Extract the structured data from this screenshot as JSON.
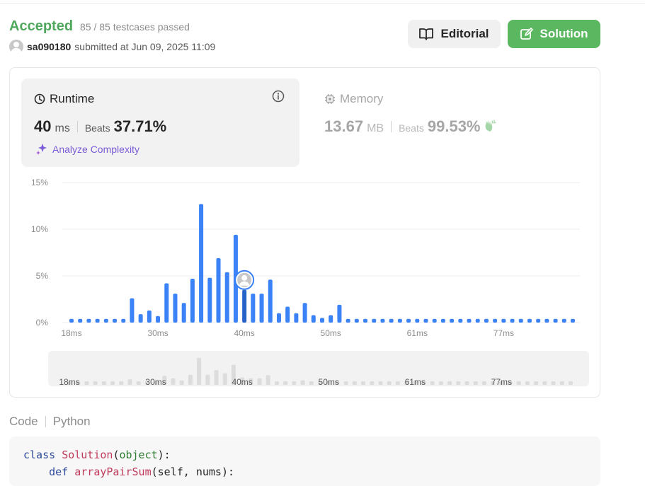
{
  "status": {
    "label": "Accepted",
    "testcases": "85 / 85 testcases passed"
  },
  "submission": {
    "user": "sa090180",
    "submitted_text": "submitted at Jun 09, 2025 11:09"
  },
  "buttons": {
    "editorial": "Editorial",
    "solution": "Solution"
  },
  "runtime": {
    "title": "Runtime",
    "value": "40",
    "unit": "ms",
    "beats_label": "Beats",
    "beats_value": "37.71%",
    "analyze": "Analyze Complexity"
  },
  "memory": {
    "title": "Memory",
    "value": "13.67",
    "unit": "MB",
    "beats_label": "Beats",
    "beats_value": "99.53%"
  },
  "colors": {
    "accepted": "#4fa85c",
    "bar": "#3b82f6",
    "accent": "#5cb860",
    "analyze": "#7b5cd6"
  },
  "chart_data": {
    "type": "bar",
    "y_ticks": [
      "15%",
      "10%",
      "5%",
      "0%"
    ],
    "ylim": [
      0,
      15
    ],
    "x_tick_labels": [
      "18ms",
      "30ms",
      "40ms",
      "50ms",
      "61ms",
      "77ms"
    ],
    "values": [
      0.4,
      0.4,
      0.4,
      0.4,
      0.4,
      0.4,
      0.4,
      2.6,
      0.9,
      1.3,
      0.7,
      4.2,
      3.1,
      2.1,
      4.7,
      12.7,
      4.8,
      6.9,
      5.4,
      9.4,
      3.5,
      3.1,
      3.1,
      4.6,
      1.0,
      1.7,
      1.0,
      2.1,
      0.8,
      0.5,
      0.8,
      1.9,
      0.4,
      0.4,
      0.4,
      0.4,
      0.4,
      0.4,
      0.4,
      0.4,
      0.4,
      0.4,
      0.4,
      0.4,
      0.4,
      0.4,
      0.4,
      0.4,
      0.4,
      0.4,
      0.4,
      0.4,
      0.4,
      0.4,
      0.4,
      0.4,
      0.4,
      0.4,
      0.4
    ],
    "highlighted_index": 20,
    "grid": true
  },
  "code": {
    "tab_label": "Code",
    "language": "Python",
    "lines": [
      [
        {
          "t": "class ",
          "c": "kw"
        },
        {
          "t": "Solution",
          "c": "cls"
        },
        {
          "t": "(",
          "c": "plain"
        },
        {
          "t": "object",
          "c": "bi"
        },
        {
          "t": "):",
          "c": "plain"
        }
      ],
      [
        {
          "t": "    ",
          "c": "plain"
        },
        {
          "t": "def ",
          "c": "kw"
        },
        {
          "t": "arrayPairSum",
          "c": "cls"
        },
        {
          "t": "(self, nums):",
          "c": "plain"
        }
      ]
    ]
  }
}
